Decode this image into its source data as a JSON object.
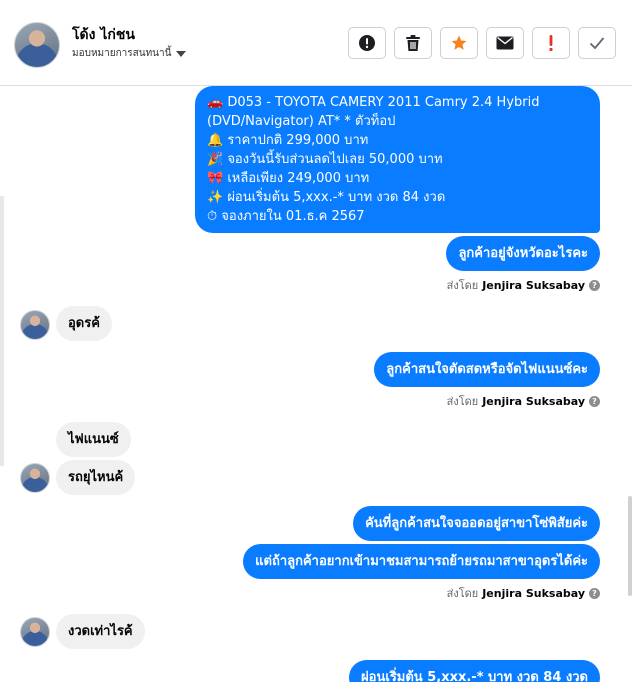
{
  "header": {
    "contact_name": "โด้ง ไก่ชน",
    "assign_label": "มอบหมายการสนทนานี้",
    "toolbar": [
      "spam-icon",
      "trash-icon",
      "star-icon",
      "envelope-icon",
      "alert-icon",
      "check-icon"
    ]
  },
  "messages": {
    "car_offer": {
      "line1": "🚗 D053 - TOYOTA CAMERY 2011 Camry 2.4 Hybrid",
      "line2": "(DVD/Navigator) AT* * ตัวท็อป",
      "line3": "🔔 ราคาปกติ 299,000 บาท",
      "line4": "🎉 จองวันนี้รับส่วนลดไปเลย 50,000 บาท",
      "line5": "🎀 เหลือเพียง 249,000 บาท",
      "line6": "✨ ผ่อนเริ่มต้น 5,xxx.-* บาท งวด 84 งวด",
      "line7": "⏱ จองภายใน 01.ธ.ค 2567"
    },
    "ask_province": "ลูกค้าอยู่จังหวัดอะไรคะ",
    "reply_udon": "อุดรค้",
    "ask_cash_finance": "ลูกค้าสนใจตัดสดหรือจัดไฟแนนซ์คะ",
    "reply_finance": "ไฟแนนซ์",
    "reply_where_car": "รถยุไหนค้",
    "car_location": "คันที่ลูกค้าสนใจจออดอยู่สาขาโซ่พิสัยค่ะ",
    "transfer_branch": "แต่ถ้าลูกค้าอยากเข้ามาชมสามารถย้ายรถมาสาขาอุดรได้ค่ะ",
    "reply_installment": "งวดเท่าไรค้",
    "installment_answer": "ผ่อนเริ่มต้น 5,xxx.-* บาท งวด 84 งวด"
  },
  "sent_by": {
    "prefix": "ส่งโดย",
    "agent": "Jenjira Suksabay",
    "help": "?"
  }
}
